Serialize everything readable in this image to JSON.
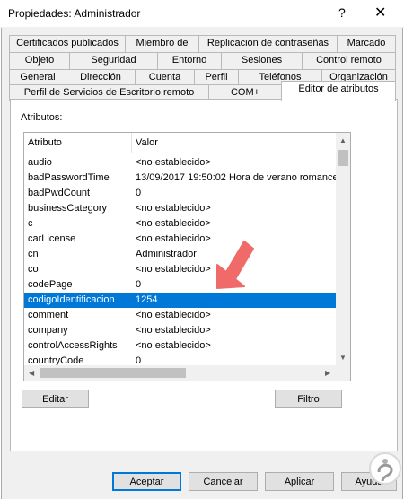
{
  "window": {
    "title": "Propiedades: Administrador",
    "help_glyph": "?",
    "close_glyph": "✕"
  },
  "tabs": {
    "row1": [
      "Certificados publicados",
      "Miembro de",
      "Replicación de contraseñas",
      "Marcado"
    ],
    "row2": [
      "Objeto",
      "Seguridad",
      "Entorno",
      "Sesiones",
      "Control remoto"
    ],
    "row3": [
      "General",
      "Dirección",
      "Cuenta",
      "Perfil",
      "Teléfonos",
      "Organización"
    ],
    "row4": [
      "Perfil de Servicios de Escritorio remoto",
      "COM+",
      "Editor de atributos"
    ],
    "active": "Editor de atributos"
  },
  "panel": {
    "attributes_label": "Atributos:",
    "columns": [
      "Atributo",
      "Valor"
    ],
    "rows": [
      {
        "name": "audio",
        "value": "<no establecido>"
      },
      {
        "name": "badPasswordTime",
        "value": "13/09/2017 19:50:02 Hora de verano romance"
      },
      {
        "name": "badPwdCount",
        "value": "0"
      },
      {
        "name": "businessCategory",
        "value": "<no establecido>"
      },
      {
        "name": "c",
        "value": "<no establecido>"
      },
      {
        "name": "carLicense",
        "value": "<no establecido>"
      },
      {
        "name": "cn",
        "value": "Administrador"
      },
      {
        "name": "co",
        "value": "<no establecido>"
      },
      {
        "name": "codePage",
        "value": "0"
      },
      {
        "name": "codigoIdentificacion",
        "value": "1254",
        "selected": true
      },
      {
        "name": "comment",
        "value": "<no establecido>"
      },
      {
        "name": "company",
        "value": "<no establecido>"
      },
      {
        "name": "controlAccessRights",
        "value": "<no establecido>"
      },
      {
        "name": "countryCode",
        "value": "0"
      }
    ],
    "edit_button": "Editar",
    "filter_button": "Filtro"
  },
  "footer": {
    "ok": "Aceptar",
    "cancel": "Cancelar",
    "apply": "Aplicar",
    "help": "Ayuda"
  },
  "colors": {
    "selection": "#0078d7",
    "pointer_arrow": "#f06a6a"
  },
  "icons": {
    "pointer": "red-pointer-arrow-icon",
    "watermark": "solvetic-watermark-icon"
  }
}
